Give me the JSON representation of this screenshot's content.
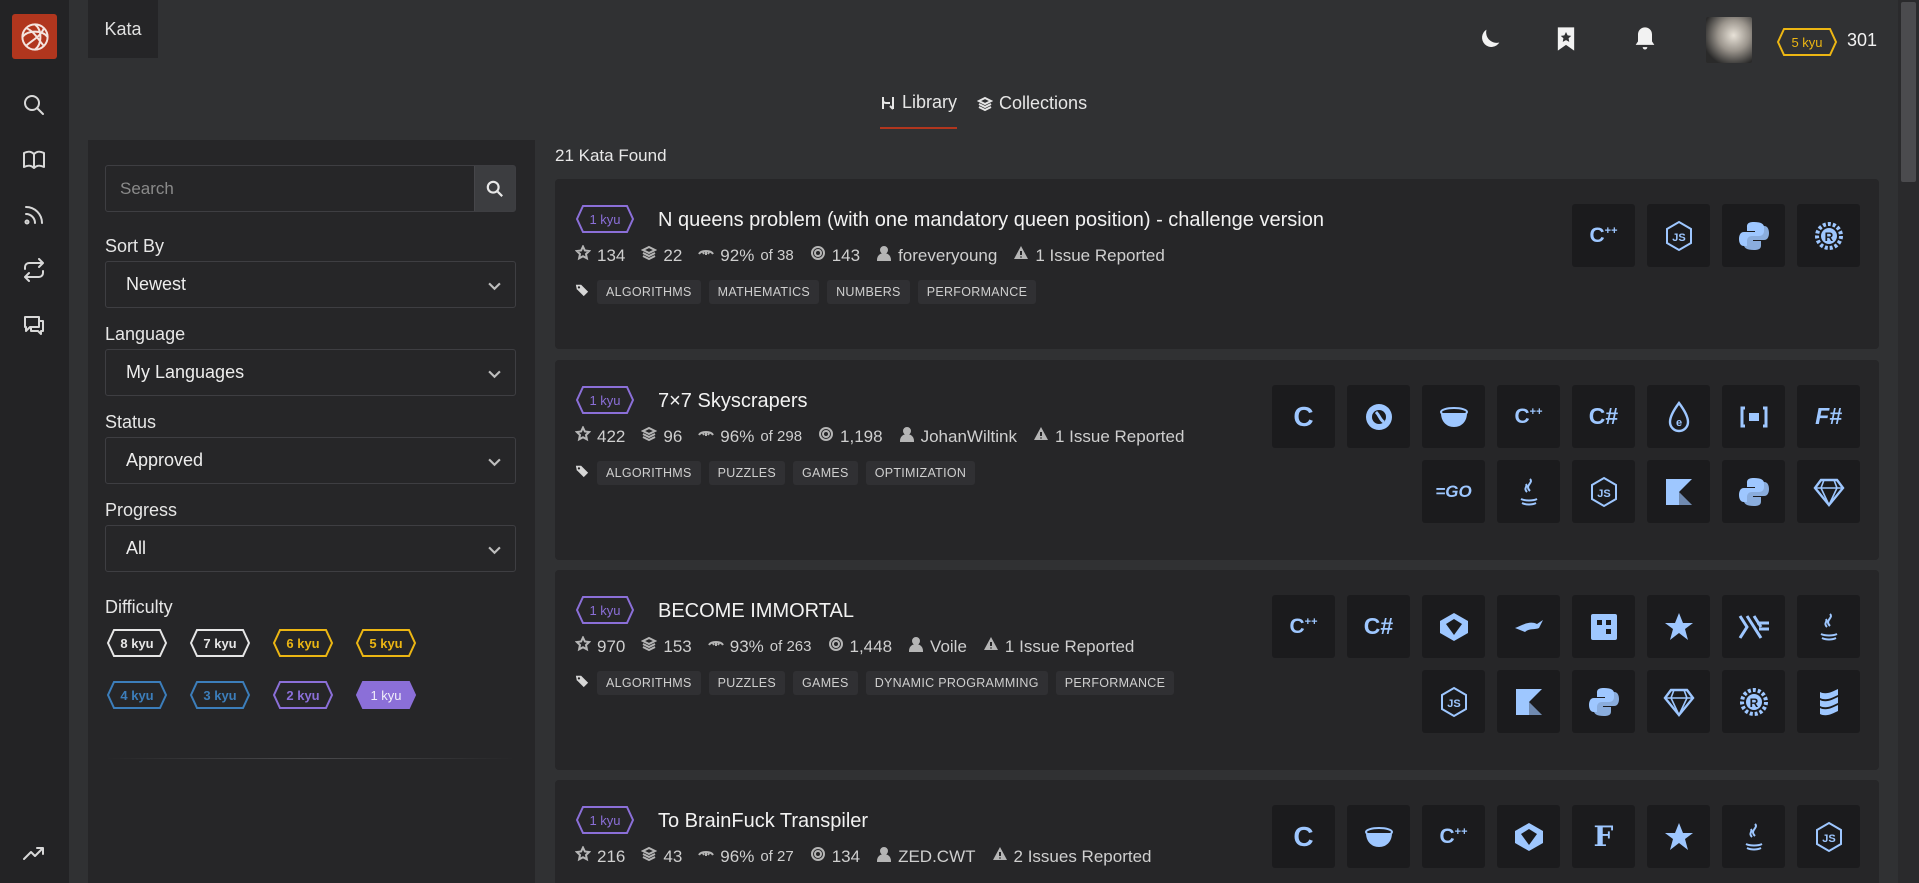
{
  "breadcrumb": "Kata",
  "user": {
    "rank": "5 kyu",
    "honor": "301"
  },
  "tabs": [
    {
      "label": "Library",
      "icon": "library-icon"
    },
    {
      "label": "Collections",
      "icon": "stack-icon"
    }
  ],
  "search": {
    "placeholder": "Search",
    "value": ""
  },
  "filters": {
    "sort_label": "Sort By",
    "sort_value": "Newest",
    "language_label": "Language",
    "language_value": "My Languages",
    "status_label": "Status",
    "status_value": "Approved",
    "progress_label": "Progress",
    "progress_value": "All",
    "difficulty_label": "Difficulty",
    "difficulties": [
      "8 kyu",
      "7 kyu",
      "6 kyu",
      "5 kyu",
      "4 kyu",
      "3 kyu",
      "2 kyu",
      "1 kyu"
    ],
    "selected_difficulty": "1 kyu"
  },
  "results_count": "21 Kata Found",
  "colors": {
    "accent": "#b1361e",
    "kyu1": "#8b6fd8",
    "kyu5": "#ecb613",
    "kyu3": "#3c7ebb",
    "lang": "#9ec7ff"
  },
  "katas": [
    {
      "rank": "1 kyu",
      "title": "N queens problem (with one mandatory queen position) - challenge version",
      "stars": "134",
      "collections": "22",
      "satisfaction": "92%",
      "votes": "of 38",
      "completed": "143",
      "author": "foreveryoung",
      "issues": "1 Issue Reported",
      "tags": [
        "ALGORITHMS",
        "MATHEMATICS",
        "NUMBERS",
        "PERFORMANCE"
      ],
      "languages": [
        "cpp",
        "javascript",
        "python",
        "rust"
      ]
    },
    {
      "rank": "1 kyu",
      "title": "7×7 Skyscrapers",
      "stars": "422",
      "collections": "96",
      "satisfaction": "96%",
      "votes": "of 298",
      "completed": "1,198",
      "author": "JohanWiltink",
      "issues": "1 Issue Reported",
      "tags": [
        "ALGORITHMS",
        "PUZZLES",
        "GAMES",
        "OPTIMIZATION"
      ],
      "languages": [
        "c",
        "clojure",
        "coffeescript",
        "cpp",
        "csharp",
        "elixir",
        "factor",
        "fsharp",
        "go",
        "java",
        "javascript",
        "kotlin",
        "python",
        "ruby"
      ]
    },
    {
      "rank": "1 kyu",
      "title": "BECOME IMMORTAL",
      "stars": "970",
      "collections": "153",
      "satisfaction": "93%",
      "votes": "of 263",
      "completed": "1,448",
      "author": "Voile",
      "issues": "1 Issue Reported",
      "tags": [
        "ALGORITHMS",
        "PUZZLES",
        "GAMES",
        "DYNAMIC PROGRAMMING",
        "PERFORMANCE"
      ],
      "languages": [
        "cpp",
        "csharp",
        "crystal",
        "dart",
        "elm",
        "fortran",
        "haskell",
        "java",
        "javascript",
        "kotlin",
        "python",
        "ruby",
        "rust",
        "scala"
      ]
    },
    {
      "rank": "1 kyu",
      "title": "To BrainFuck Transpiler",
      "stars": "216",
      "collections": "43",
      "satisfaction": "96%",
      "votes": "of 27",
      "completed": "134",
      "author": "ZED.CWT",
      "issues": "2 Issues Reported",
      "tags": [],
      "languages": [
        "c",
        "coffeescript",
        "cpp",
        "crystal",
        "fsharp2",
        "fortran",
        "java",
        "javascript"
      ]
    }
  ]
}
